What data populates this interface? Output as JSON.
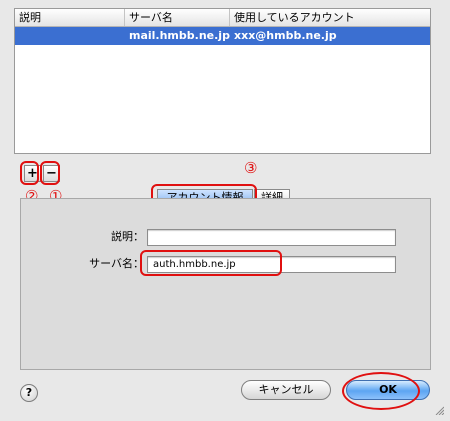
{
  "table": {
    "columns": [
      "説明",
      "サーバ名",
      "使用しているアカウント"
    ],
    "rows": [
      {
        "description": "",
        "server": "mail.hmbb.ne.jp",
        "account": "xxx@hmbb.ne.jp"
      }
    ]
  },
  "buttons": {
    "add": "+",
    "remove": "−"
  },
  "annotations": {
    "one": "①",
    "two": "②",
    "three": "③"
  },
  "tabs": [
    {
      "label": "アカウント情報"
    },
    {
      "label": "詳細"
    }
  ],
  "form": {
    "description_label": "説明：",
    "description_value": "",
    "server_label": "サーバ名：",
    "server_value": "auth.hmbb.ne.jp"
  },
  "footer": {
    "help": "?",
    "cancel_label": "キャンセル",
    "ok_label": "OK"
  },
  "colors": {
    "selection": "#3b6fd1",
    "annotation": "#e01010",
    "default_button": "#5da5f2"
  }
}
